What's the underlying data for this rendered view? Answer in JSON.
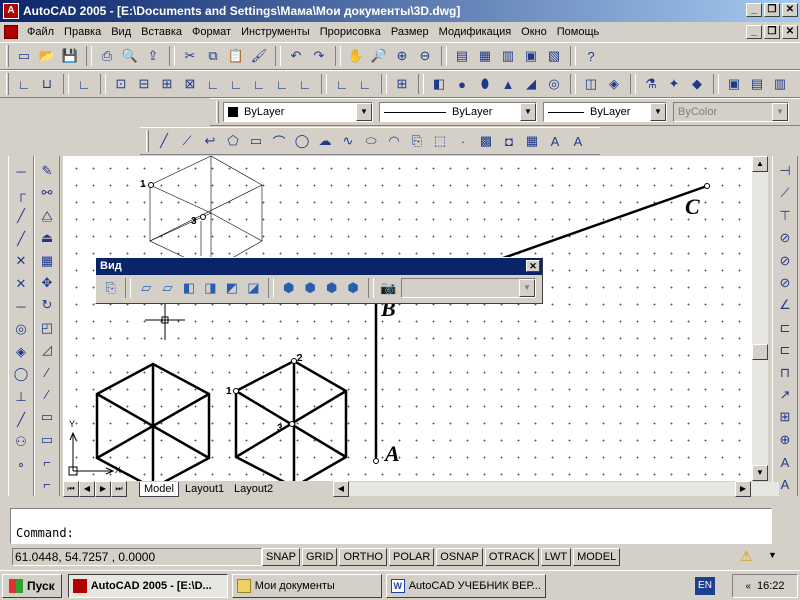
{
  "window": {
    "app_icon": "A",
    "title": "AutoCAD 2005 - [E:\\Documents and Settings\\Мама\\Мои документы\\3D.dwg]",
    "minimize": "_",
    "restore": "❐",
    "close": "✕"
  },
  "menu": [
    "Файл",
    "Правка",
    "Вид",
    "Вставка",
    "Формат",
    "Инструменты",
    "Прорисовка",
    "Размер",
    "Модификация",
    "Окно",
    "Помощь"
  ],
  "properties": {
    "color": "ByLayer",
    "linetype": "ByLayer",
    "lineweight": "ByLayer",
    "plotstyle": "ByColor"
  },
  "drawing": {
    "points": {
      "a": "A",
      "b": "B",
      "c": "C"
    },
    "iso_labels": {
      "one": "1",
      "two": "2",
      "three": "3"
    },
    "ucs": {
      "x": "X",
      "y": "Y"
    }
  },
  "view_toolbar": {
    "title": "Вид",
    "close": "✕",
    "combo_value": ""
  },
  "tabs": [
    "Model",
    "Layout1",
    "Layout2"
  ],
  "command": {
    "prompt": "Command:"
  },
  "status": {
    "coordinates": "61.0448,  54.7257 , 0.0000",
    "modes": [
      "SNAP",
      "GRID",
      "ORTHO",
      "POLAR",
      "OSNAP",
      "OTRACK",
      "LWT",
      "MODEL"
    ]
  },
  "taskbar": {
    "start": "Пуск",
    "tasks": [
      "AutoCAD 2005 - [E:\\D...",
      "Мои документы",
      "AutoCAD УЧЕБНИК ВЕР..."
    ],
    "language": "EN",
    "time": "16:22"
  },
  "colors": {
    "title_active": "#0a246a",
    "canvas": "#ffffff",
    "workspace": "#d4d0c8"
  }
}
